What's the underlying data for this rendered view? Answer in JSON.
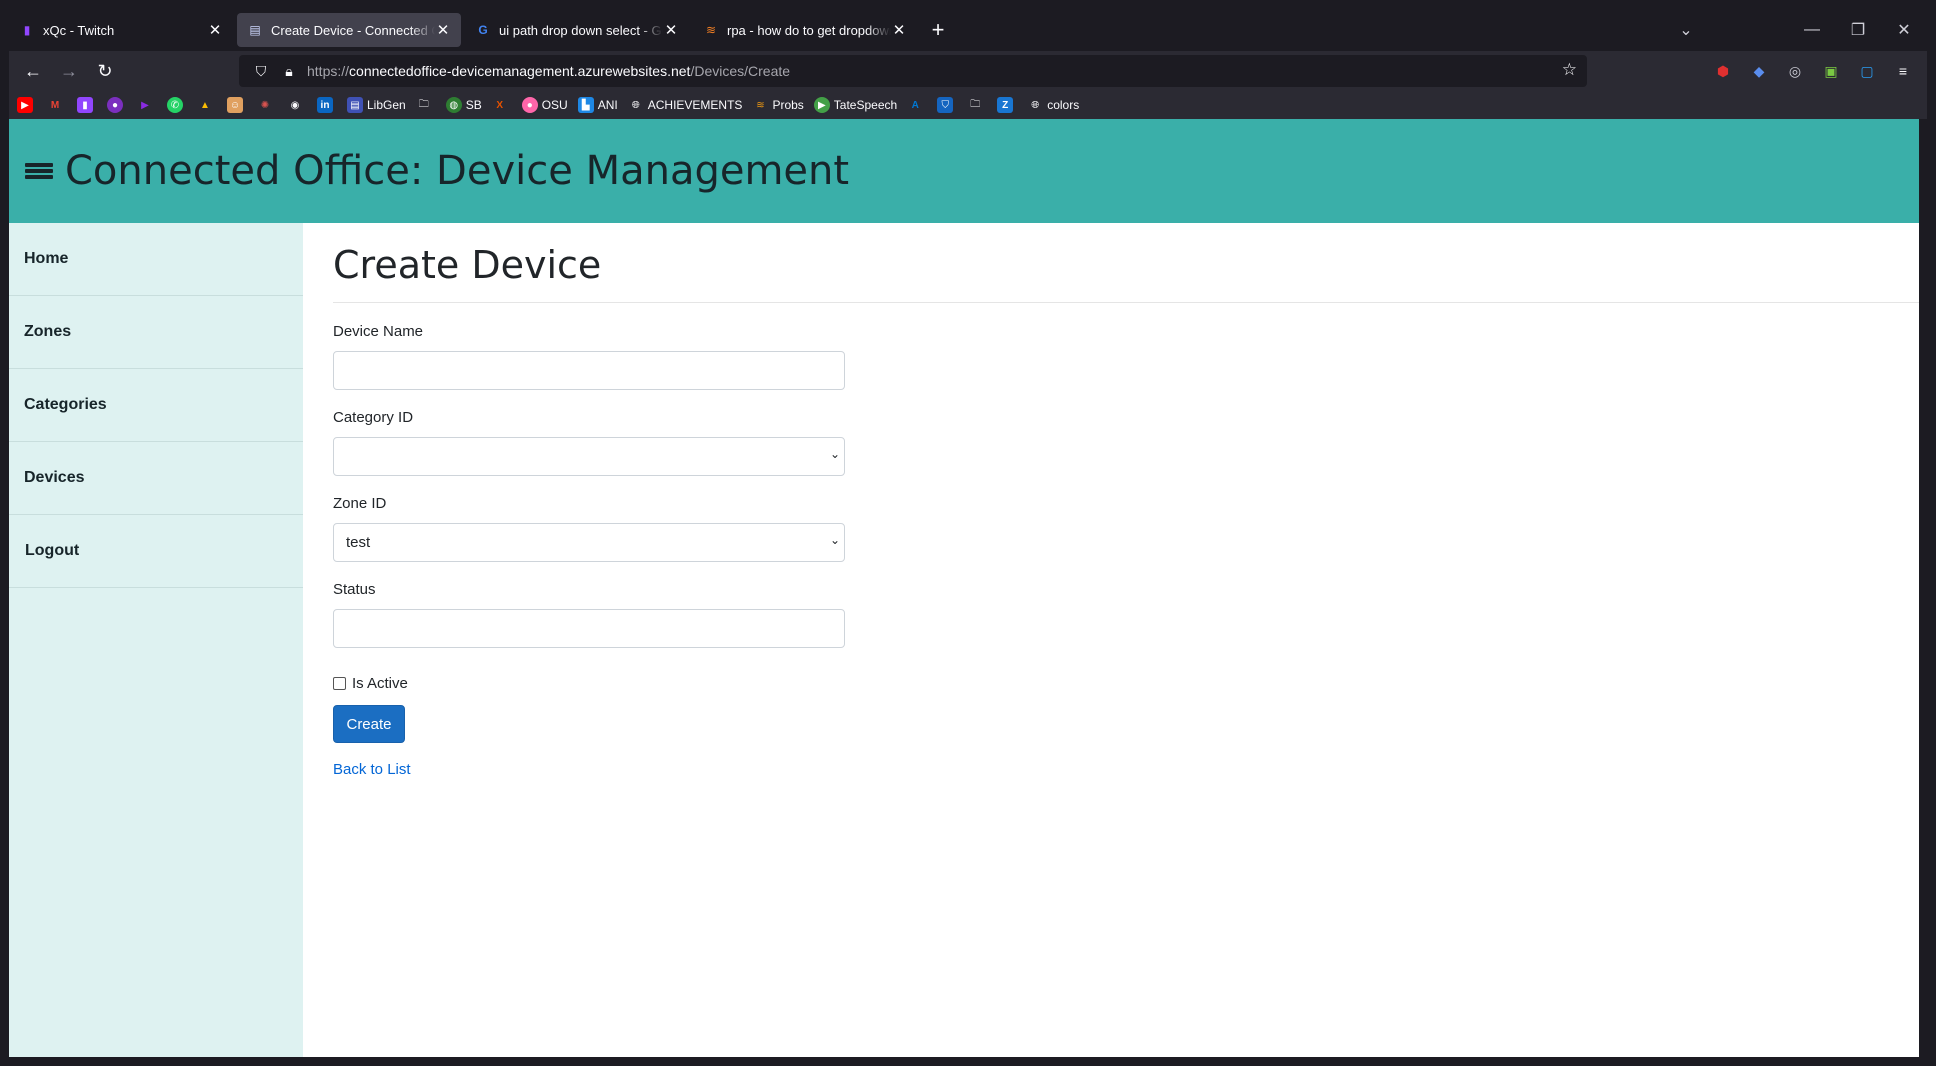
{
  "browser": {
    "tabs": [
      {
        "title": "xQc - Twitch",
        "icon": "twitch-icon",
        "color": "#9146ff",
        "active": false
      },
      {
        "title": "Create Device - Connected Office",
        "icon": "document-icon",
        "color": "#cfd8ff",
        "active": true
      },
      {
        "title": "ui path drop down select - Google",
        "icon": "google-icon",
        "color": "#4285f4",
        "active": false
      },
      {
        "title": "rpa - how do to get dropdown values",
        "icon": "stackoverflow-icon",
        "color": "#f48024",
        "active": false
      }
    ],
    "url_scheme": "https://",
    "url_host": "connectedoffice-devicemanagement.azurewebsites.net",
    "url_path": "/Devices/Create",
    "bookmarks": [
      {
        "label": "",
        "icon": "youtube-icon",
        "color": "#ff0000"
      },
      {
        "label": "",
        "icon": "gmail-icon",
        "color": "#ea4335"
      },
      {
        "label": "",
        "icon": "twitch-icon",
        "color": "#9146ff"
      },
      {
        "label": "",
        "icon": "purple-icon",
        "color": "#7b2fbf"
      },
      {
        "label": "",
        "icon": "play-icon",
        "color": "#8a2be2"
      },
      {
        "label": "",
        "icon": "whatsapp-icon",
        "color": "#25d366"
      },
      {
        "label": "",
        "icon": "drive-icon",
        "color": "#fbbc04"
      },
      {
        "label": "",
        "icon": "avatar-icon",
        "color": "#e0a060"
      },
      {
        "label": "",
        "icon": "crab-icon",
        "color": "#d9534f"
      },
      {
        "label": "",
        "icon": "github-icon",
        "color": "#333333"
      },
      {
        "label": "",
        "icon": "linkedin-icon",
        "color": "#0a66c2"
      },
      {
        "label": "LibGen",
        "icon": "book-icon",
        "color": "#3f51b5"
      },
      {
        "label": "",
        "icon": "folder-icon",
        "color": "#555555"
      },
      {
        "label": "SB",
        "icon": "globe-icon",
        "color": "#2e7d32"
      },
      {
        "label": "",
        "icon": "x-icon",
        "color": "#e65100"
      },
      {
        "label": "OSU",
        "icon": "osu-icon",
        "color": "#ff66aa"
      },
      {
        "label": "ANI",
        "icon": "ani-icon",
        "color": "#1e88e5"
      },
      {
        "label": "ACHIEVEMENTS",
        "icon": "globe-icon",
        "color": "#555555"
      },
      {
        "label": "Probs",
        "icon": "probs-icon",
        "color": "#f39c12"
      },
      {
        "label": "TateSpeech",
        "icon": "play-circle-icon",
        "color": "#43a047"
      },
      {
        "label": "",
        "icon": "azure-icon",
        "color": "#0078d4"
      },
      {
        "label": "",
        "icon": "shield-icon",
        "color": "#1565c0"
      },
      {
        "label": "",
        "icon": "folder-icon",
        "color": "#555555"
      },
      {
        "label": "",
        "icon": "z-icon",
        "color": "#1976d2"
      },
      {
        "label": "colors",
        "icon": "globe-icon",
        "color": "#555555"
      }
    ]
  },
  "app": {
    "title": "Connected Office: Device Management",
    "header_color": "#3aafa9",
    "sidebar_color": "#def2f1",
    "sidebar": [
      {
        "label": "Home"
      },
      {
        "label": "Zones"
      },
      {
        "label": "Categories"
      },
      {
        "label": "Devices"
      },
      {
        "label": "Logout"
      }
    ]
  },
  "form": {
    "heading": "Create Device",
    "device_name_label": "Device Name",
    "device_name_value": "",
    "category_label": "Category ID",
    "category_value": "",
    "zone_label": "Zone ID",
    "zone_value": "test",
    "status_label": "Status",
    "status_value": "",
    "is_active_label": "Is Active",
    "is_active_checked": false,
    "submit_label": "Create",
    "back_link": "Back to List",
    "button_color": "#1b6ec2",
    "link_color": "#0366d6"
  }
}
